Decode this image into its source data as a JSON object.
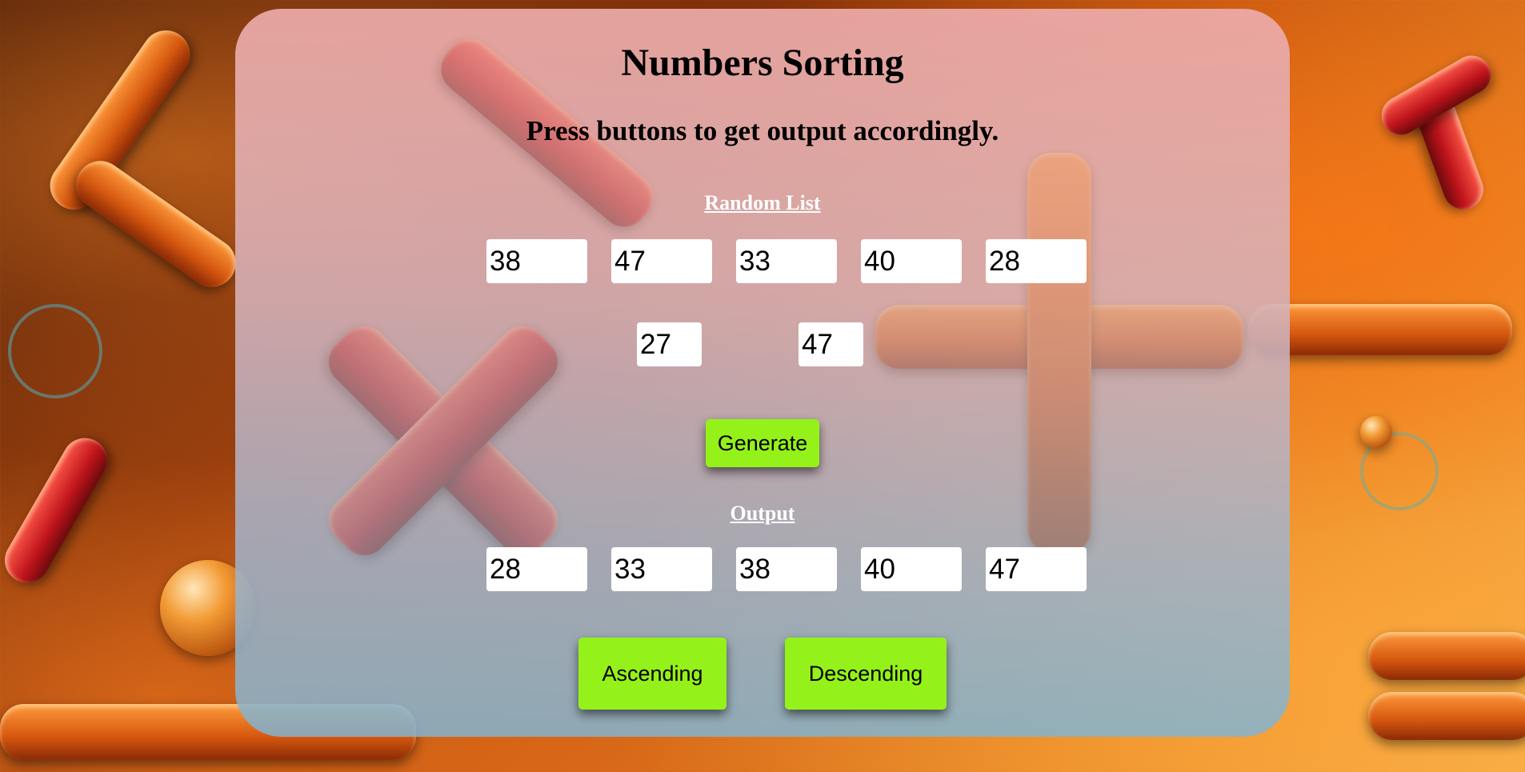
{
  "title": "Numbers Sorting",
  "subtitle": "Press buttons to get output accordingly.",
  "random_list": {
    "label": "Random List",
    "values": [
      "38",
      "47",
      "33",
      "40",
      "28"
    ],
    "extra_values": [
      "27",
      "47"
    ]
  },
  "generate_label": "Generate",
  "output": {
    "label": "Output",
    "values": [
      "28",
      "33",
      "38",
      "40",
      "47"
    ]
  },
  "ascending_label": "Ascending",
  "descending_label": "Descending",
  "colors": {
    "button": "#95f11a",
    "label_text": "#ffffff",
    "heading_text": "#000000"
  }
}
